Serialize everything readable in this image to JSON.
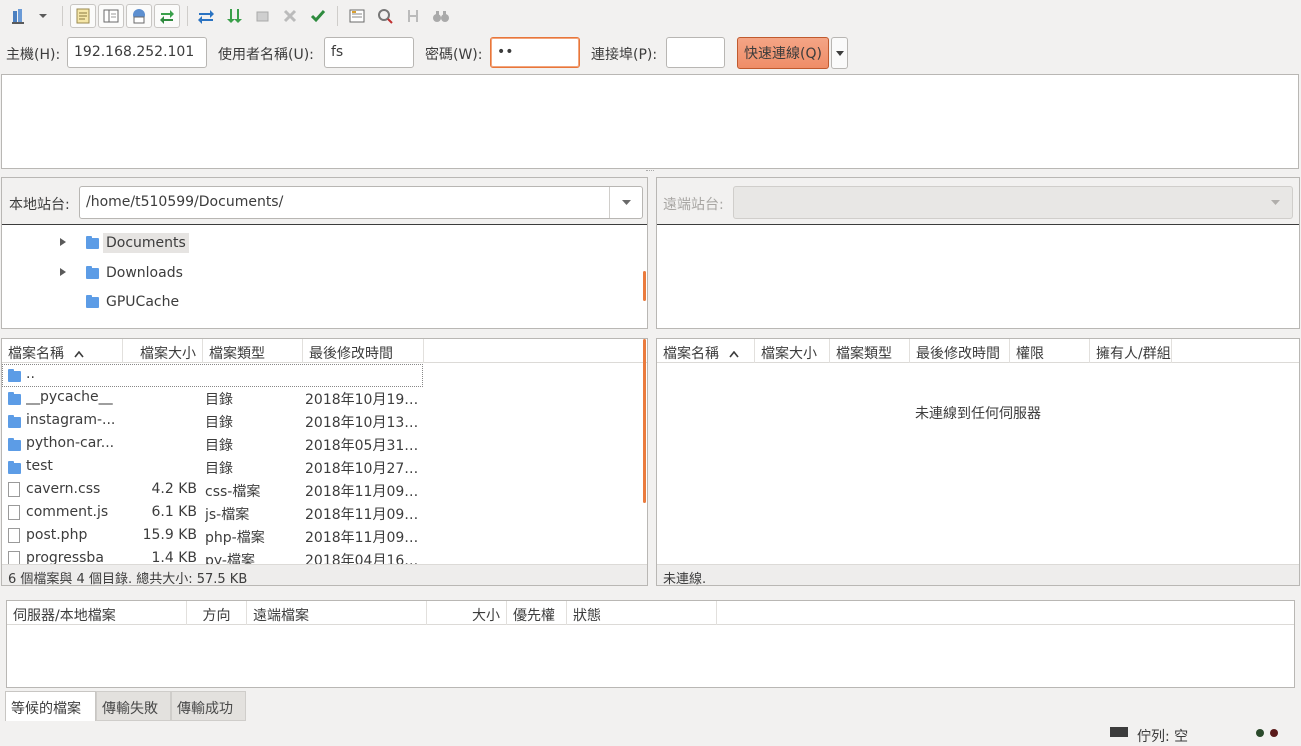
{
  "toolbar": {
    "icons": [
      "site-manager-icon",
      "site-manager-dropdown-icon",
      "message-log-icon",
      "directory-tree-icon",
      "remote-tree-icon",
      "transfer-queue-icon",
      "refresh-icon",
      "process-queue-icon",
      "cancel-icon",
      "disconnect-icon",
      "reconnect-icon",
      "filter-icon",
      "compare-icon",
      "sync-browse-icon",
      "search-icon"
    ]
  },
  "quickconnect": {
    "host_label": "主機(H):",
    "host_value": "192.168.252.101",
    "user_label": "使用者名稱(U):",
    "user_value": "fs",
    "pass_label": "密碼(W):",
    "pass_value": "••",
    "port_label": "連接埠(P):",
    "port_value": "",
    "connect_button": "快速連線(Q)"
  },
  "local": {
    "site_label": "本地站台:",
    "path": "/home/t510599/Documents/",
    "tree": [
      {
        "name": "Documents",
        "expandable": true,
        "selected": true
      },
      {
        "name": "Downloads",
        "expandable": true,
        "selected": false
      },
      {
        "name": "GPUCache",
        "expandable": false,
        "selected": false
      }
    ],
    "columns": [
      "檔案名稱",
      "檔案大小",
      "檔案類型",
      "最後修改時間"
    ],
    "files": [
      {
        "name": "..",
        "size": "",
        "type": "",
        "modified": "",
        "kind": "folder"
      },
      {
        "name": "__pycache__",
        "size": "",
        "type": "目錄",
        "modified": "2018年10月19…",
        "kind": "folder"
      },
      {
        "name": "instagram-...",
        "size": "",
        "type": "目錄",
        "modified": "2018年10月13…",
        "kind": "folder"
      },
      {
        "name": "python-car...",
        "size": "",
        "type": "目錄",
        "modified": "2018年05月31…",
        "kind": "folder"
      },
      {
        "name": "test",
        "size": "",
        "type": "目錄",
        "modified": "2018年10月27…",
        "kind": "folder"
      },
      {
        "name": "cavern.css",
        "size": "4.2 KB",
        "type": "css-檔案",
        "modified": "2018年11月09…",
        "kind": "file"
      },
      {
        "name": "comment.js",
        "size": "6.1 KB",
        "type": "js-檔案",
        "modified": "2018年11月09…",
        "kind": "file"
      },
      {
        "name": "post.php",
        "size": "15.9 KB",
        "type": "php-檔案",
        "modified": "2018年11月09…",
        "kind": "file"
      },
      {
        "name": "progressba",
        "size": "1.4 KB",
        "type": "py-檔案",
        "modified": "2018年04月16…",
        "kind": "file"
      }
    ],
    "status": "6 個檔案與 4 個目錄. 總共大小: 57.5 KB"
  },
  "remote": {
    "site_label": "遠端站台:",
    "path": "",
    "columns": [
      "檔案名稱",
      "檔案大小",
      "檔案類型",
      "最後修改時間",
      "權限",
      "擁有人/群組"
    ],
    "empty_message": "未連線到任何伺服器",
    "status": "未連線."
  },
  "queue": {
    "columns": [
      "伺服器/本地檔案",
      "方向",
      "遠端檔案",
      "大小",
      "優先權",
      "狀態"
    ],
    "tabs": [
      "等候的檔案",
      "傳輸失敗",
      "傳輸成功"
    ],
    "queue_status": "佇列: 空"
  },
  "colors": {
    "accent": "#ef8d67",
    "folder": "#5c9ce6",
    "scroll_indicator": "#ea7b3e"
  }
}
